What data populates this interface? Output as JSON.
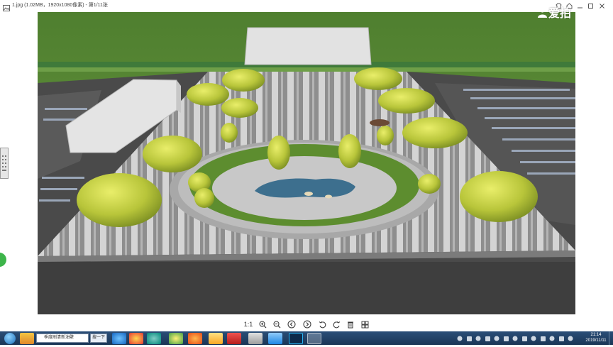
{
  "window": {
    "title": "1.jpg (1.02MB，1920x1080像素) - 第1/11张"
  },
  "watermark": {
    "text": "爱拍"
  },
  "toolbar": {
    "actual_size_label": "1:1"
  },
  "taskbar": {
    "search_text": "季度刷清新油壁",
    "search_button": "搜一下",
    "clock_time": "21:14",
    "clock_date": "2019/11/11"
  },
  "colors": {
    "grass": "#5e8f3a",
    "plaza": "#9a9a9a",
    "paving_light": "#d2d2d2",
    "road": "#3c3c3c",
    "taskbar": "#1f3f66",
    "accent_green": "#3db54a"
  }
}
